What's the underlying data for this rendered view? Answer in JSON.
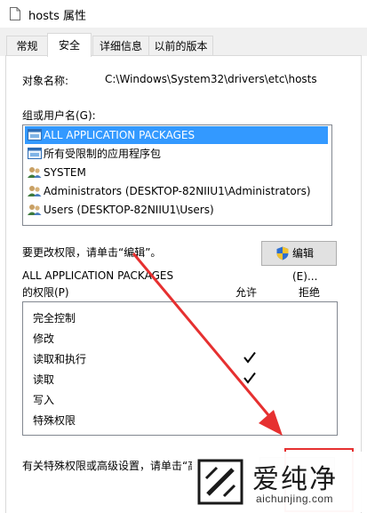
{
  "window": {
    "title": "hosts 属性"
  },
  "tabs": [
    {
      "label": "常规"
    },
    {
      "label": "安全"
    },
    {
      "label": "详细信息"
    },
    {
      "label": "以前的版本"
    }
  ],
  "object": {
    "label": "对象名称:",
    "value": "C:\\Windows\\System32\\drivers\\etc\\hosts"
  },
  "groups": {
    "label": "组或用户名(G):",
    "items": [
      {
        "label": "ALL APPLICATION PACKAGES",
        "icon": "app-packages-icon",
        "selected": true
      },
      {
        "label": "所有受限制的应用程序包",
        "icon": "app-packages-icon",
        "selected": false
      },
      {
        "label": "SYSTEM",
        "icon": "users-icon",
        "selected": false
      },
      {
        "label": "Administrators (DESKTOP-82NIIU1\\Administrators)",
        "icon": "users-icon",
        "selected": false
      },
      {
        "label": "Users (DESKTOP-82NIIU1\\Users)",
        "icon": "users-icon",
        "selected": false
      }
    ]
  },
  "change_hint": "要更改权限，请单击“编辑”。",
  "edit_button": "编辑(E)...",
  "permissions": {
    "header_line1": "ALL APPLICATION PACKAGES",
    "header_line2": "的权限(P)",
    "col_allow": "允许",
    "col_deny": "拒绝",
    "rows": [
      {
        "label": "完全控制",
        "allow": false,
        "deny": false
      },
      {
        "label": "修改",
        "allow": false,
        "deny": false
      },
      {
        "label": "读取和执行",
        "allow": true,
        "deny": false
      },
      {
        "label": "读取",
        "allow": true,
        "deny": false
      },
      {
        "label": "写入",
        "allow": false,
        "deny": false
      },
      {
        "label": "特殊权限",
        "allow": false,
        "deny": false
      }
    ]
  },
  "advanced_hint": "有关特殊权限或高级设置，请单击“高",
  "watermark": {
    "text_cn": "爱纯净",
    "url": "aichunjing.com"
  },
  "colors": {
    "selection": "#3399ff",
    "annotation": "#e63030"
  }
}
